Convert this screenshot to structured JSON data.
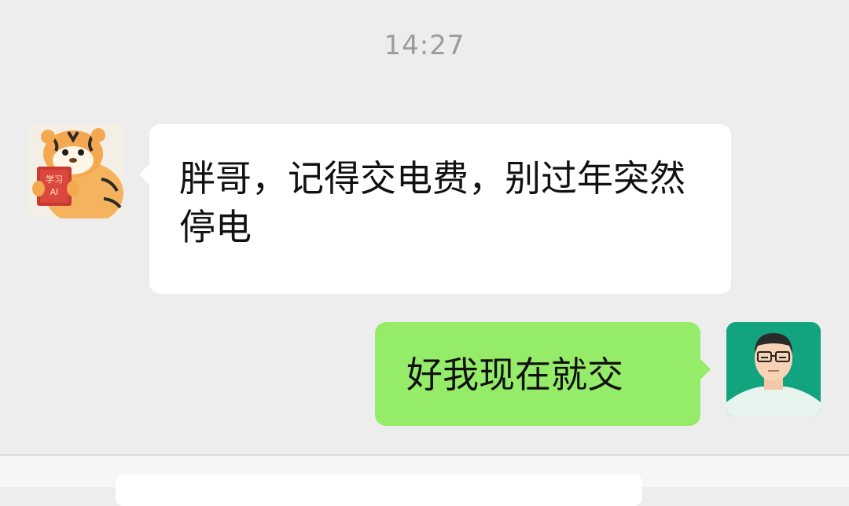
{
  "chat": {
    "timestamp": "14:27",
    "messages": [
      {
        "direction": "incoming",
        "sender_avatar": "tiger-reading-book-avatar",
        "text": "胖哥，记得交电费，别过年突然停电"
      },
      {
        "direction": "outgoing",
        "sender_avatar": "man-with-glasses-avatar",
        "text": "好我现在就交"
      }
    ]
  },
  "input": {
    "value": "",
    "placeholder": ""
  },
  "colors": {
    "background": "#ededed",
    "incoming_bubble": "#ffffff",
    "outgoing_bubble": "#95ec69",
    "timestamp": "#9b9b9b",
    "avatar_right_bg": "#12a47f"
  },
  "avatar_book_text": "学习AI"
}
